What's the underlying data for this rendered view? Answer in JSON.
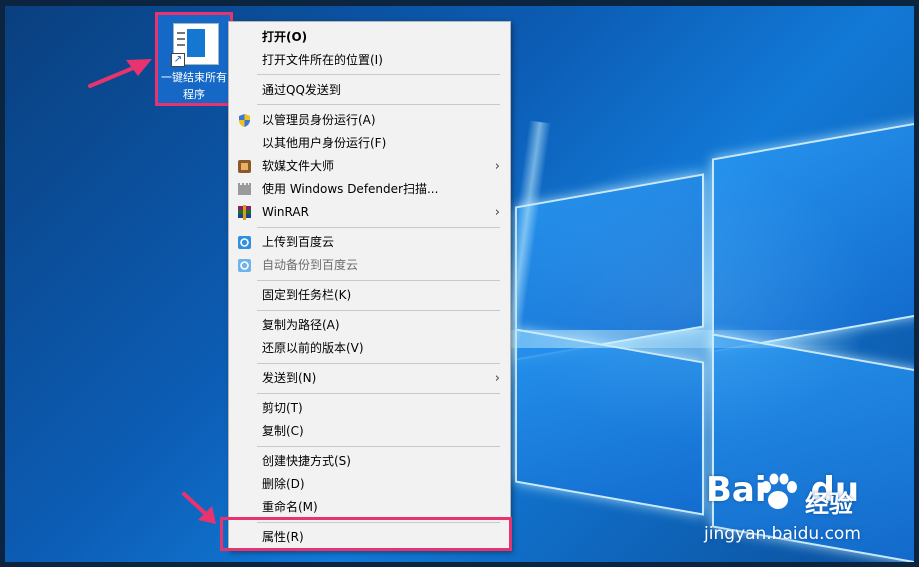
{
  "desktop": {
    "shortcut": {
      "label": "一键结束所有程序"
    }
  },
  "context_menu": {
    "items": [
      {
        "label": "打开(O)",
        "bold": true
      },
      {
        "label": "打开文件所在的位置(I)"
      },
      {
        "label": "通过QQ发送到"
      },
      {
        "label": "以管理员身份运行(A)",
        "icon": "shield-icon"
      },
      {
        "label": "以其他用户身份运行(F)"
      },
      {
        "label": "软媒文件大师",
        "icon": "file-master-icon",
        "submenu": true
      },
      {
        "label": "使用 Windows Defender扫描...",
        "icon": "defender-icon"
      },
      {
        "label": "WinRAR",
        "icon": "winrar-icon",
        "submenu": true
      },
      {
        "label": "上传到百度云",
        "icon": "baidu-cloud-icon"
      },
      {
        "label": "自动备份到百度云",
        "icon": "baidu-cloud-icon",
        "disabled": true
      },
      {
        "label": "固定到任务栏(K)"
      },
      {
        "label": "复制为路径(A)"
      },
      {
        "label": "还原以前的版本(V)"
      },
      {
        "label": "发送到(N)",
        "submenu": true
      },
      {
        "label": "剪切(T)"
      },
      {
        "label": "复制(C)"
      },
      {
        "label": "创建快捷方式(S)"
      },
      {
        "label": "删除(D)"
      },
      {
        "label": "重命名(M)"
      },
      {
        "label": "属性(R)"
      }
    ]
  },
  "watermark": {
    "brand_bai": "Bai",
    "brand_du": "du",
    "brand_cn": "经验",
    "url": "jingyan.baidu.com"
  },
  "colors": {
    "highlight": "#e8336e",
    "menu_bg": "#f2f2f2",
    "desktop_blue": "#0c5db5"
  }
}
